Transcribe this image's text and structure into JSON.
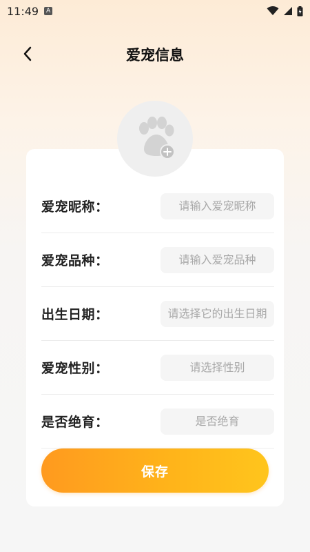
{
  "status_bar": {
    "time": "11:49",
    "notification_icon_letter": "A"
  },
  "header": {
    "title": "爱宠信息"
  },
  "avatar": {
    "icon": "paw-icon",
    "add_icon": "plus-icon"
  },
  "form": {
    "fields": [
      {
        "label": "爱宠昵称：",
        "placeholder": "请输入爱宠昵称",
        "value": ""
      },
      {
        "label": "爱宠品种：",
        "placeholder": "请输入爱宠品种",
        "value": ""
      },
      {
        "label": "出生日期：",
        "placeholder": "请选择它的出生日期",
        "value": ""
      },
      {
        "label": "爱宠性别：",
        "placeholder": "请选择性别",
        "value": ""
      },
      {
        "label": "是否绝育：",
        "placeholder": "是否绝育",
        "value": ""
      }
    ]
  },
  "save_button": {
    "label": "保存"
  },
  "colors": {
    "accent_start": "#ff9a1f",
    "accent_end": "#ffc51c",
    "input_bg": "#f5f5f5"
  }
}
